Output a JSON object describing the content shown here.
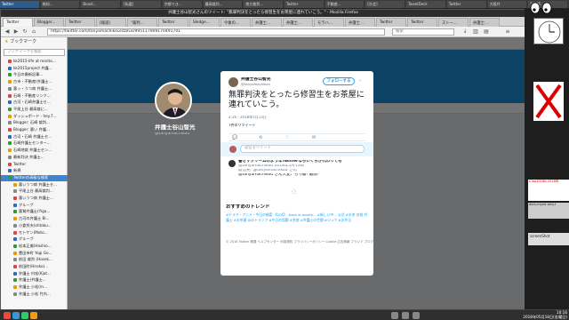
{
  "taskbar_top": {
    "tabs": [
      "Twitter",
      "報知...",
      "Boost...",
      "[転載]",
      "京都でき...",
      "最高裁判...",
      "地方裁判...",
      "Twitter",
      "不動産...",
      "[社会]",
      "TweetDeck",
      "Twitter",
      "大阪弁",
      "5/大阪..."
    ]
  },
  "window": {
    "title": "弁護士谷山智光さんのツイート: \"無罪判決をとったら修習生をお茶屋に連れていこう。\" - Mozilla Firefox"
  },
  "browser_tabs": [
    "Twitter",
    "Blogger...",
    "Twitter",
    "[報道]",
    "\"裁判...",
    "Twitter",
    "Sledge...",
    "今後の...",
    "弁護士...",
    "弁護士...",
    "モラハ...",
    "弁護士...",
    "Twitter",
    "Twitter",
    "ストー...",
    "弁護士..."
  ],
  "navbar": {
    "url": "https://twitter.com/tanyamachikou/status/995117909170491701",
    "search_placeholder": "検索"
  },
  "sidebar": {
    "header": "ブックマーク",
    "search_placeholder": "ブックマークを検索",
    "items": [
      {
        "label": "kk2015-life at monto...",
        "selected": false
      },
      {
        "label": "kk2015project 弁護...",
        "selected": false
      },
      {
        "label": "今日の最新記事...",
        "selected": false
      },
      {
        "label": "古市・不動産(弁護士...",
        "selected": false
      },
      {
        "label": "悪ッ・うつ病 弁護士...",
        "selected": false
      },
      {
        "label": "石崎・不動産リンク...",
        "selected": false
      },
      {
        "label": "古河・石崎弁護士セ...",
        "selected": false
      },
      {
        "label": "平尾上谷 最高裁に...",
        "selected": false
      },
      {
        "label": "ダッシュボード - hey.7...",
        "selected": false
      },
      {
        "label": "Blogger: 石崎 裁判...",
        "selected": false
      },
      {
        "label": "Blogger: 悪い 弁護...",
        "selected": false
      },
      {
        "label": "古河・石崎 弁護士セ...",
        "selected": false
      },
      {
        "label": "石崎弁護士センター...",
        "selected": false
      },
      {
        "label": "石崎地裁 弁護士セン...",
        "selected": false
      },
      {
        "label": "最新判決 弁護士...",
        "selected": false
      },
      {
        "label": "Twitter",
        "selected": false
      },
      {
        "label": "新規",
        "selected": false
      },
      {
        "label": "Twitterの高級な検索",
        "selected": true
      },
      {
        "label": "悪いうつ病 弁護士セ...",
        "selected": false
      },
      {
        "label": "平尾上谷 最高裁判...",
        "selected": false
      },
      {
        "label": "悪いうつ病 弁護士...",
        "selected": false
      },
      {
        "label": "グループ",
        "selected": false
      },
      {
        "label": "悪質弁護士(Yiga...",
        "selected": false
      },
      {
        "label": "古河の弁護士 Bl...",
        "selected": false
      },
      {
        "label": "小倉秀夫(ohtaku...",
        "selected": false
      },
      {
        "label": "モトケン(Moto...",
        "selected": false
      },
      {
        "label": "グループ",
        "selected": false
      },
      {
        "label": "松本正美(Hashio...",
        "selected": false
      },
      {
        "label": "豊田市町 Yogi Go...",
        "selected": false
      },
      {
        "label": "前田 裁判 (Hosek...",
        "selected": false
      },
      {
        "label": "前田町(Hiroko)...",
        "selected": false
      },
      {
        "label": "弁護士 村松(Kjat...",
        "selected": false
      },
      {
        "label": "弁護士(弁護士...",
        "selected": false
      },
      {
        "label": "弁護士 小松(m...",
        "selected": false
      },
      {
        "label": "弁護士 小松 竹内...",
        "selected": false
      }
    ]
  },
  "profile": {
    "name": "弁護士谷山智光",
    "handle": "@tanyamachikou"
  },
  "tweet": {
    "author_name": "弁護士谷山智光",
    "author_handle": "@tanyamachikou",
    "follow_label": "フォローする",
    "text": "無罪判決をとったら修習生をお茶屋に連れていこう。",
    "timestamp": "2:16 - 2018年5月13日",
    "retweets": "7件のリツイート",
    "reply_placeholder": "返信をツイート",
    "reply": {
      "name": "書きサクリームのようなTwitterならいくらか代わりても",
      "meta": "@tanyamachikou 2018年5月13日",
      "reply_to": "返信先: @tanyamachikou さん",
      "text": "@tanyamachikou さん大変、ちっ最! 最前!"
    }
  },
  "trends": {
    "title": "おすすめのトレンド",
    "list": "#ドラマ・アニメ・今日の検索 【公式】 #zoo ai-assets... #新しい中... 公式 #お茶 名前 弁護士 #お茶屋 AIのトランプ #今日の話題 #名前 #弁護士の世間 #ジュウ #お弁当"
  },
  "footer": "© 2018 Twitter 概要 ヘルプセンター 利用規約 プライバシーポリシー Cookie 広告情報 ブランド ブログ",
  "desktop": {
    "widget1": "s wp2018b 2018年",
    "widget2": "dom-myed-ainy.t",
    "widget3": "screenShot"
  },
  "clock": {
    "time": "10:16",
    "date": "2018年05月18日(金曜日)"
  },
  "colors": {
    "twitter_blue": "#1da1f2",
    "sidebar_selected": "#3d84d1"
  }
}
